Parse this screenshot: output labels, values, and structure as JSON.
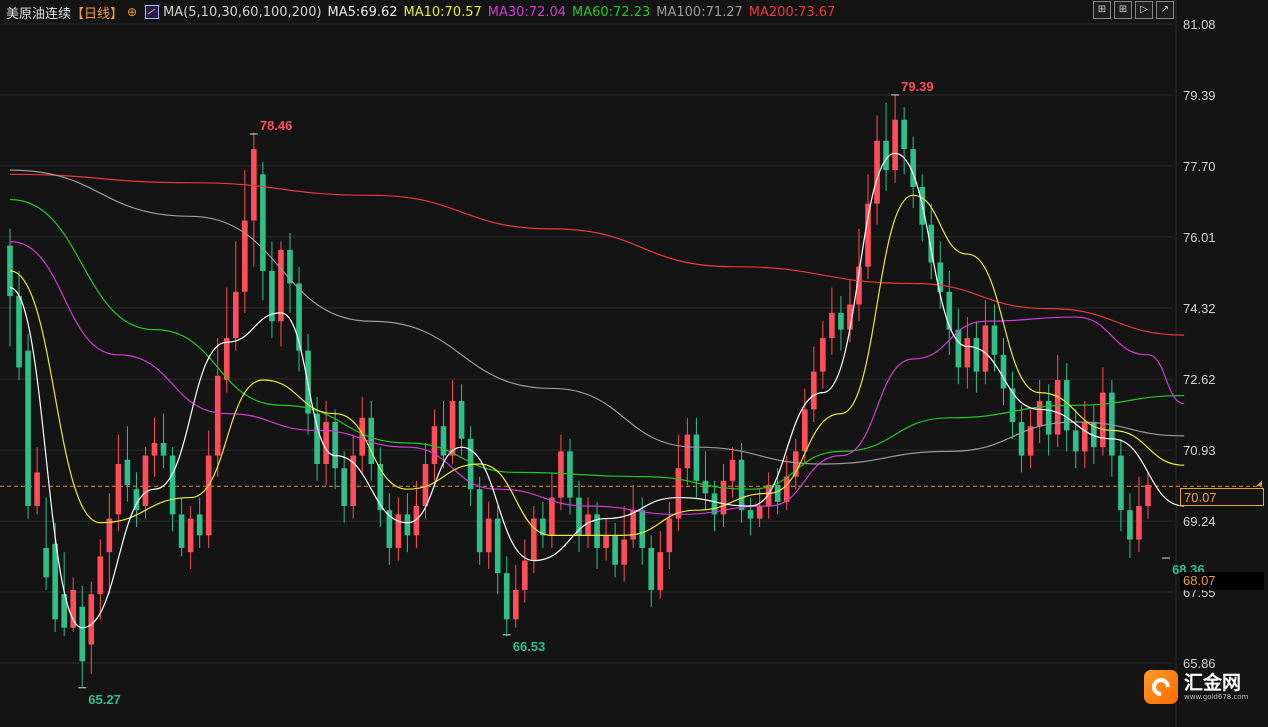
{
  "header": {
    "title": "美原油连续",
    "period": "【日线】",
    "gear_icon": "settings-gear-icon",
    "ma_icon": "ma-chart-icon",
    "ma_params": "MA(5,10,30,60,100,200)",
    "ma5": "MA5:69.62",
    "ma10": "MA10:70.57",
    "ma30": "MA30:72.04",
    "ma60": "MA60:72.23",
    "ma100": "MA100:71.27",
    "ma200": "MA200:73.67"
  },
  "toolbar": {
    "btn1": "⊞",
    "btn2": "⊞",
    "btn3": "▷",
    "btn4": "↗",
    "icons": [
      "crosshair-icon",
      "grid-icon",
      "play-icon",
      "export-icon"
    ]
  },
  "price_tags": {
    "current": "70.07",
    "low": "68.07"
  },
  "logo": {
    "name": "汇金网",
    "url": "www.gold678.com"
  },
  "colors": {
    "up": "#ff4d5a",
    "down": "#2fbf8a",
    "ma5": "#ffffff",
    "ma10": "#e8e83a",
    "ma30": "#d03ad0",
    "ma60": "#26c426",
    "ma100": "#9a9a9a",
    "ma200": "#e83a3a",
    "grid": "#2c2c2c",
    "dash": "#e0902a"
  },
  "chart_data": {
    "type": "candlestick",
    "y_ticks": [
      "81.08",
      "79.39",
      "77.70",
      "76.01",
      "74.32",
      "72.62",
      "70.93",
      "69.24",
      "67.55",
      "65.86"
    ],
    "ylim": [
      65.0,
      81.6
    ],
    "annotations": {
      "high1": "78.46",
      "high2": "79.39",
      "low1": "65.27",
      "low2": "66.53",
      "low3": "68.36"
    },
    "current_price": 70.07,
    "candles": [
      [
        75.8,
        74.6,
        76.2,
        73.4
      ],
      [
        74.6,
        72.9,
        75.2,
        72.6
      ],
      [
        73.3,
        69.6,
        73.7,
        69.3
      ],
      [
        69.6,
        70.4,
        71.0,
        69.4
      ],
      [
        68.6,
        67.9,
        69.8,
        67.6
      ],
      [
        68.7,
        66.9,
        69.2,
        66.6
      ],
      [
        67.5,
        66.7,
        68.5,
        66.5
      ],
      [
        66.7,
        67.6,
        67.9,
        66.6
      ],
      [
        67.2,
        65.9,
        67.7,
        65.3
      ],
      [
        66.3,
        67.5,
        67.8,
        65.6
      ],
      [
        67.5,
        68.4,
        68.8,
        66.9
      ],
      [
        68.5,
        69.3,
        69.9,
        67.5
      ],
      [
        69.4,
        70.6,
        71.3,
        69.0
      ],
      [
        70.7,
        70.1,
        71.5,
        69.7
      ],
      [
        70.0,
        69.5,
        70.4,
        69.1
      ],
      [
        69.6,
        70.8,
        71.0,
        69.3
      ],
      [
        70.8,
        71.1,
        71.7,
        70.3
      ],
      [
        71.1,
        70.8,
        71.8,
        70.5
      ],
      [
        70.8,
        69.4,
        71.0,
        69.0
      ],
      [
        69.4,
        68.6,
        69.8,
        68.4
      ],
      [
        68.5,
        69.3,
        69.6,
        68.1
      ],
      [
        69.4,
        68.9,
        69.8,
        68.6
      ],
      [
        68.9,
        70.8,
        71.4,
        68.6
      ],
      [
        70.8,
        72.7,
        73.6,
        70.3
      ],
      [
        72.6,
        73.6,
        74.8,
        72.3
      ],
      [
        73.6,
        74.7,
        75.9,
        73.3
      ],
      [
        74.7,
        76.4,
        77.6,
        74.2
      ],
      [
        76.4,
        78.1,
        78.5,
        75.3
      ],
      [
        77.5,
        75.2,
        77.8,
        74.5
      ],
      [
        75.2,
        74.0,
        75.9,
        73.6
      ],
      [
        74.0,
        75.7,
        75.9,
        73.4
      ],
      [
        75.7,
        74.9,
        76.1,
        74.2
      ],
      [
        74.9,
        73.3,
        75.3,
        72.8
      ],
      [
        73.3,
        71.8,
        73.7,
        71.3
      ],
      [
        71.8,
        70.6,
        72.2,
        70.2
      ],
      [
        70.6,
        71.6,
        72.1,
        70.1
      ],
      [
        71.6,
        70.5,
        71.9,
        70.0
      ],
      [
        70.5,
        69.6,
        70.9,
        69.2
      ],
      [
        69.6,
        70.8,
        71.3,
        69.3
      ],
      [
        70.8,
        71.7,
        72.2,
        70.4
      ],
      [
        71.7,
        70.6,
        72.1,
        70.2
      ],
      [
        70.6,
        69.5,
        71.0,
        69.1
      ],
      [
        69.5,
        68.6,
        69.9,
        68.2
      ],
      [
        68.6,
        69.4,
        69.8,
        68.3
      ],
      [
        69.4,
        68.9,
        69.9,
        68.5
      ],
      [
        68.9,
        69.6,
        70.2,
        68.6
      ],
      [
        69.6,
        70.6,
        71.1,
        69.3
      ],
      [
        70.6,
        71.5,
        71.9,
        70.2
      ],
      [
        71.5,
        70.8,
        72.1,
        70.5
      ],
      [
        70.8,
        72.1,
        72.6,
        70.6
      ],
      [
        72.1,
        71.2,
        72.5,
        70.8
      ],
      [
        71.2,
        70.0,
        71.5,
        69.6
      ],
      [
        70.0,
        68.5,
        70.3,
        68.2
      ],
      [
        68.5,
        69.3,
        69.7,
        68.1
      ],
      [
        69.3,
        68.0,
        69.6,
        67.5
      ],
      [
        68.0,
        66.9,
        68.4,
        66.5
      ],
      [
        66.9,
        67.6,
        68.2,
        66.7
      ],
      [
        67.6,
        68.3,
        68.8,
        67.3
      ],
      [
        68.3,
        69.3,
        69.6,
        68.0
      ],
      [
        69.3,
        68.9,
        69.7,
        68.6
      ],
      [
        68.9,
        69.8,
        70.4,
        68.6
      ],
      [
        69.8,
        70.9,
        71.3,
        69.5
      ],
      [
        70.9,
        69.8,
        71.2,
        69.4
      ],
      [
        69.8,
        68.9,
        70.2,
        68.5
      ],
      [
        68.9,
        69.4,
        69.8,
        68.6
      ],
      [
        69.4,
        68.6,
        69.7,
        68.1
      ],
      [
        68.6,
        68.9,
        69.3,
        68.3
      ],
      [
        68.9,
        68.2,
        69.2,
        67.9
      ],
      [
        68.2,
        68.8,
        69.6,
        67.8
      ],
      [
        68.8,
        69.5,
        70.1,
        68.6
      ],
      [
        69.5,
        68.6,
        69.8,
        68.2
      ],
      [
        68.6,
        67.6,
        68.9,
        67.2
      ],
      [
        67.6,
        68.5,
        69.0,
        67.4
      ],
      [
        68.5,
        69.3,
        69.7,
        68.1
      ],
      [
        69.3,
        70.5,
        71.3,
        69.0
      ],
      [
        70.5,
        71.3,
        71.7,
        70.1
      ],
      [
        71.3,
        70.2,
        71.7,
        69.8
      ],
      [
        70.2,
        69.9,
        70.9,
        69.5
      ],
      [
        69.9,
        69.4,
        70.2,
        69.0
      ],
      [
        69.4,
        70.2,
        70.6,
        69.1
      ],
      [
        70.2,
        70.7,
        71.0,
        69.8
      ],
      [
        70.7,
        69.5,
        71.1,
        69.2
      ],
      [
        69.5,
        69.3,
        69.8,
        68.9
      ],
      [
        69.3,
        69.6,
        70.0,
        69.1
      ],
      [
        69.6,
        70.1,
        70.4,
        69.3
      ],
      [
        70.1,
        69.7,
        70.5,
        69.4
      ],
      [
        69.7,
        70.3,
        70.8,
        69.5
      ],
      [
        70.3,
        70.9,
        71.2,
        70.0
      ],
      [
        70.9,
        71.9,
        72.4,
        70.6
      ],
      [
        71.9,
        72.8,
        73.4,
        71.6
      ],
      [
        72.8,
        73.6,
        74.0,
        72.4
      ],
      [
        73.6,
        74.2,
        74.8,
        73.2
      ],
      [
        74.2,
        73.8,
        74.6,
        73.3
      ],
      [
        73.8,
        74.4,
        75.0,
        73.5
      ],
      [
        74.4,
        75.3,
        76.2,
        74.0
      ],
      [
        75.3,
        76.8,
        77.5,
        75.0
      ],
      [
        76.8,
        78.3,
        78.9,
        76.3
      ],
      [
        78.3,
        77.6,
        79.2,
        77.1
      ],
      [
        77.6,
        78.8,
        79.39,
        77.3
      ],
      [
        78.8,
        78.1,
        79.1,
        77.5
      ],
      [
        78.1,
        77.2,
        78.4,
        76.7
      ],
      [
        77.2,
        76.3,
        77.5,
        75.9
      ],
      [
        76.3,
        75.4,
        76.8,
        75.0
      ],
      [
        75.4,
        74.7,
        75.9,
        74.3
      ],
      [
        74.7,
        73.8,
        75.2,
        73.2
      ],
      [
        73.8,
        72.9,
        74.3,
        72.5
      ],
      [
        72.9,
        73.6,
        74.1,
        72.4
      ],
      [
        73.6,
        72.8,
        74.0,
        72.3
      ],
      [
        72.8,
        73.9,
        74.5,
        72.5
      ],
      [
        73.9,
        73.2,
        74.4,
        72.8
      ],
      [
        73.2,
        72.4,
        73.6,
        72.0
      ],
      [
        72.4,
        71.6,
        72.8,
        71.2
      ],
      [
        71.6,
        70.8,
        72.0,
        70.4
      ],
      [
        70.8,
        71.5,
        71.9,
        70.5
      ],
      [
        71.5,
        72.1,
        72.6,
        71.1
      ],
      [
        72.1,
        71.3,
        72.5,
        70.8
      ],
      [
        71.3,
        72.6,
        73.2,
        71.0
      ],
      [
        72.6,
        71.4,
        73.0,
        70.9
      ],
      [
        71.4,
        70.9,
        71.9,
        70.5
      ],
      [
        70.9,
        71.6,
        72.1,
        70.5
      ],
      [
        71.6,
        71.0,
        72.0,
        70.6
      ],
      [
        71.0,
        72.3,
        72.9,
        70.8
      ],
      [
        72.3,
        70.8,
        72.6,
        70.3
      ],
      [
        70.8,
        69.5,
        71.2,
        69.0
      ],
      [
        69.5,
        68.8,
        69.9,
        68.36
      ],
      [
        68.8,
        69.6,
        70.3,
        68.5
      ],
      [
        69.6,
        70.1,
        70.4,
        69.3
      ]
    ],
    "ma_lines": {
      "ma5": [
        [
          0,
          74.8
        ],
        [
          8,
          66.7
        ],
        [
          16,
          70.0
        ],
        [
          24,
          73.5
        ],
        [
          30,
          74.2
        ],
        [
          36,
          70.8
        ],
        [
          44,
          69.2
        ],
        [
          50,
          71.0
        ],
        [
          58,
          68.3
        ],
        [
          66,
          69.3
        ],
        [
          74,
          69.8
        ],
        [
          82,
          69.6
        ],
        [
          90,
          72.3
        ],
        [
          98,
          78.0
        ],
        [
          106,
          73.4
        ],
        [
          114,
          71.9
        ],
        [
          122,
          71.2
        ],
        [
          130,
          69.6
        ]
      ],
      "ma10": [
        [
          0,
          75.2
        ],
        [
          10,
          69.2
        ],
        [
          20,
          69.8
        ],
        [
          28,
          72.6
        ],
        [
          36,
          71.8
        ],
        [
          44,
          70.0
        ],
        [
          52,
          70.6
        ],
        [
          60,
          68.9
        ],
        [
          68,
          68.9
        ],
        [
          76,
          69.5
        ],
        [
          84,
          69.9
        ],
        [
          92,
          71.8
        ],
        [
          100,
          77.0
        ],
        [
          106,
          75.6
        ],
        [
          114,
          72.3
        ],
        [
          122,
          71.4
        ],
        [
          130,
          70.57
        ]
      ],
      "ma30": [
        [
          0,
          75.9
        ],
        [
          12,
          73.2
        ],
        [
          24,
          71.8
        ],
        [
          34,
          71.4
        ],
        [
          44,
          71.0
        ],
        [
          54,
          70.0
        ],
        [
          64,
          69.6
        ],
        [
          74,
          69.4
        ],
        [
          84,
          69.6
        ],
        [
          92,
          70.8
        ],
        [
          100,
          73.1
        ],
        [
          108,
          74.0
        ],
        [
          118,
          74.1
        ],
        [
          126,
          73.2
        ],
        [
          130,
          72.04
        ]
      ],
      "ma60": [
        [
          0,
          76.9
        ],
        [
          16,
          73.8
        ],
        [
          30,
          72.0
        ],
        [
          44,
          71.1
        ],
        [
          56,
          70.4
        ],
        [
          70,
          70.3
        ],
        [
          82,
          70.0
        ],
        [
          92,
          70.9
        ],
        [
          104,
          71.7
        ],
        [
          118,
          72.0
        ],
        [
          130,
          72.23
        ]
      ],
      "ma100": [
        [
          0,
          77.6
        ],
        [
          20,
          76.5
        ],
        [
          40,
          74.0
        ],
        [
          60,
          72.4
        ],
        [
          76,
          71.0
        ],
        [
          90,
          70.6
        ],
        [
          104,
          70.9
        ],
        [
          118,
          71.6
        ],
        [
          130,
          71.27
        ]
      ],
      "ma200": [
        [
          0,
          77.5
        ],
        [
          20,
          77.3
        ],
        [
          40,
          77.0
        ],
        [
          60,
          76.2
        ],
        [
          80,
          75.3
        ],
        [
          100,
          74.9
        ],
        [
          115,
          74.3
        ],
        [
          130,
          73.67
        ]
      ]
    }
  }
}
